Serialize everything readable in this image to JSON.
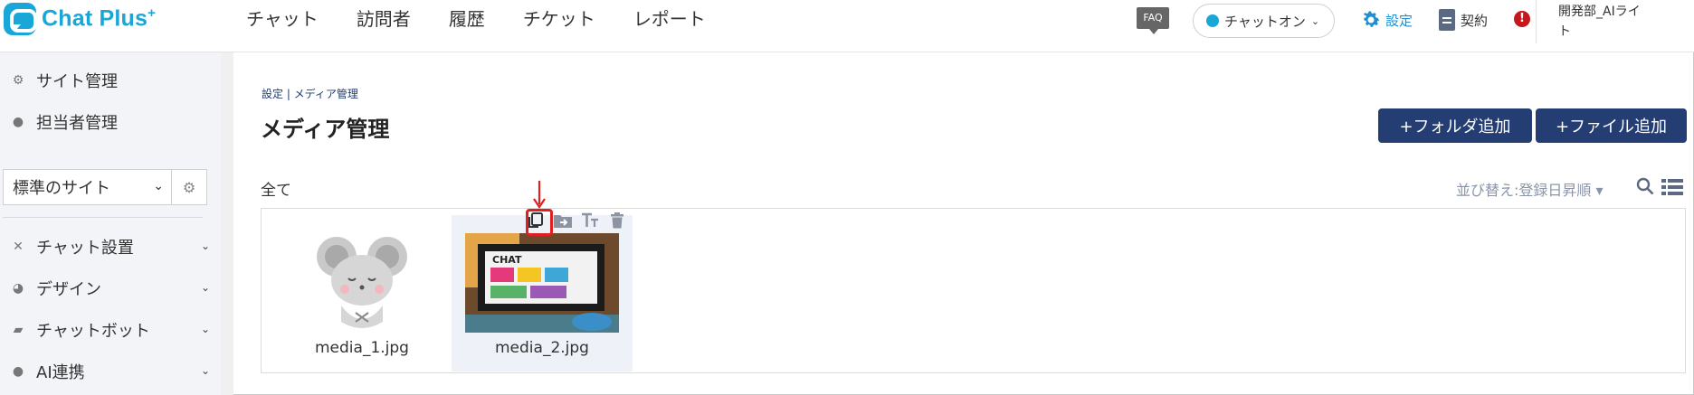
{
  "header": {
    "logo_text": "Chat Plus",
    "logo_sup": "+",
    "nav": [
      "チャット",
      "訪問者",
      "履歴",
      "チケット",
      "レポート"
    ],
    "faq_label": "FAQ",
    "status_label": "チャットオン",
    "settings_label": "設定",
    "contract_label": "契約",
    "alert_symbol": "!",
    "user_name_line1": "開発部_AIライ",
    "user_name_line2": "ト"
  },
  "sidebar": {
    "top_items": [
      {
        "label": "サイト管理",
        "icon": "gears-icon"
      },
      {
        "label": "担当者管理",
        "icon": "users-icon"
      }
    ],
    "site_select": "標準のサイト",
    "menu_items": [
      {
        "label": "チャット設置",
        "icon": "tools-icon"
      },
      {
        "label": "デザイン",
        "icon": "palette-icon"
      },
      {
        "label": "チャットボット",
        "icon": "chat-bubble-icon"
      },
      {
        "label": "AI連携",
        "icon": "ai-icon"
      }
    ]
  },
  "main": {
    "breadcrumb": "設定 | メディア管理",
    "title": "メディア管理",
    "add_folder_button": "+フォルダ追加",
    "add_file_button": "+ファイル追加",
    "folder_label": "全て",
    "sort_label": "並び替え:登録日昇順",
    "media": [
      {
        "name": "media_1.jpg",
        "selected": false
      },
      {
        "name": "media_2.jpg",
        "selected": true
      }
    ],
    "thumb_caption": "CHAT"
  },
  "colors": {
    "brand": "#19a7d8",
    "primary_button": "#243d73",
    "highlight": "#e02020"
  }
}
